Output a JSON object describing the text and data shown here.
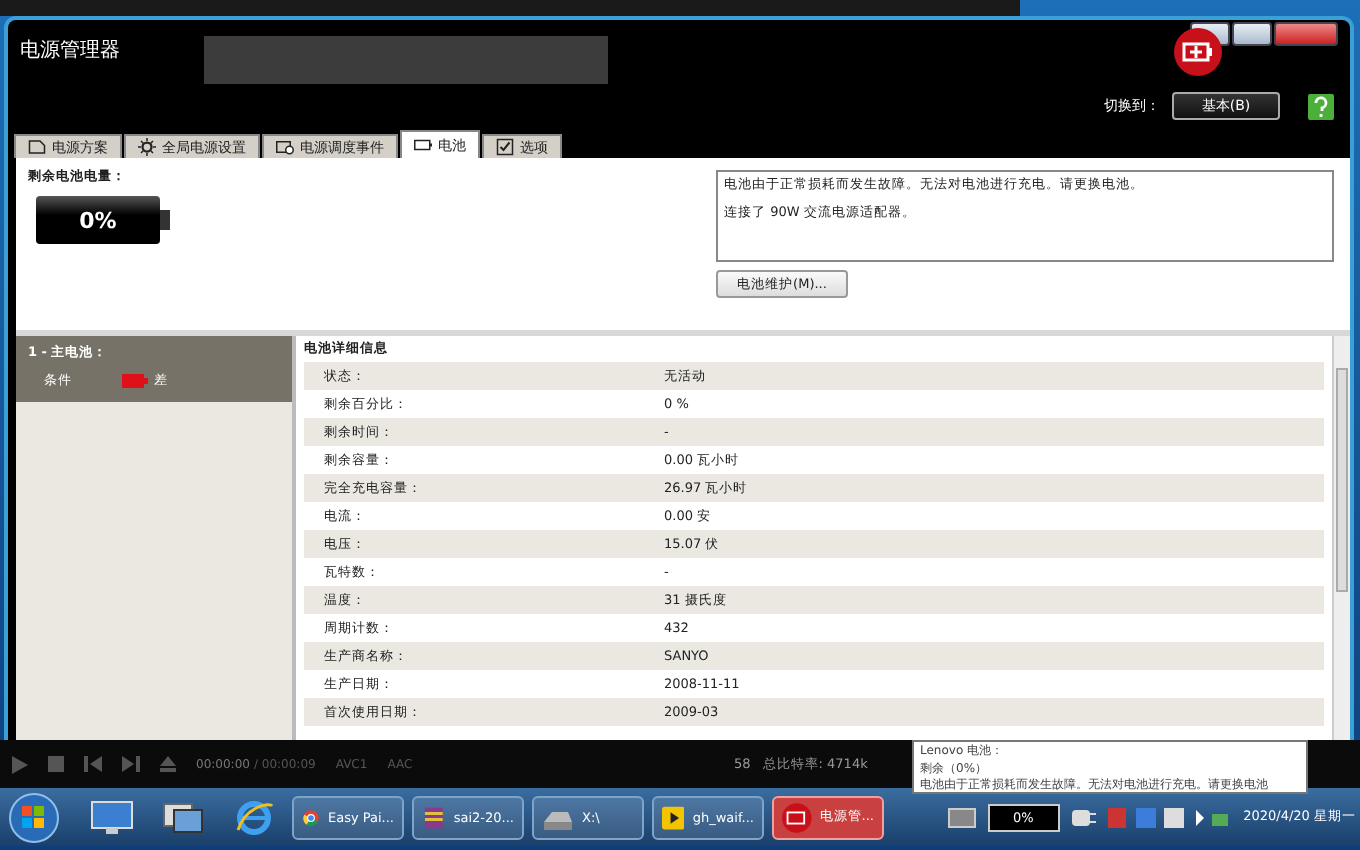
{
  "window": {
    "title": "电源管理器"
  },
  "switcher": {
    "label": "切换到：",
    "button": "基本(B)"
  },
  "tabs": [
    {
      "label": "电源方案",
      "kind": "plan",
      "selected": false
    },
    {
      "label": "全局电源设置",
      "kind": "gear",
      "selected": false
    },
    {
      "label": "电源调度事件",
      "kind": "event",
      "selected": false
    },
    {
      "label": "电池",
      "kind": "battery",
      "selected": true
    },
    {
      "label": "选项",
      "kind": "check",
      "selected": false
    }
  ],
  "battery_summary": {
    "label": "剩余电池电量：",
    "reading": "0%",
    "level": 0
  },
  "messages": [
    "电池由于正常损耗而发生故障。无法对电池进行充电。请更换电池。",
    "连接了 90W 交流电源适配器。"
  ],
  "maintenance_button": "电池维护(M)...",
  "battery_list": {
    "header": "1 - 主电池：",
    "condition_label": "条件",
    "condition": "差"
  },
  "details": {
    "title": "电池详细信息",
    "rows": [
      {
        "label": "状态：",
        "value": "无活动"
      },
      {
        "label": "剩余百分比：",
        "value": "0 %"
      },
      {
        "label": "剩余时间：",
        "value": "-"
      },
      {
        "label": "剩余容量：",
        "value": "0.00 瓦小时"
      },
      {
        "label": "完全充电容量：",
        "value": "26.97 瓦小时"
      },
      {
        "label": "电流：",
        "value": "0.00 安"
      },
      {
        "label": "电压：",
        "value": "15.07 伏"
      },
      {
        "label": "瓦特数：",
        "value": "-"
      },
      {
        "label": "温度：",
        "value": "31 摄氏度"
      },
      {
        "label": "周期计数：",
        "value": "432"
      },
      {
        "label": "生产商名称：",
        "value": "SANYO"
      },
      {
        "label": "生产日期：",
        "value": "2008-11-11"
      },
      {
        "label": "首次使用日期：",
        "value": "2009-03"
      }
    ]
  },
  "player": {
    "time": "00:00:00",
    "duration": "/ 00:00:09",
    "codecs": [
      "AVC1",
      "AAC"
    ],
    "info": [
      "58",
      "总比特率: 4714k"
    ]
  },
  "tooltip": [
    "Lenovo 电池：",
    "剩余（0%）",
    "电池由于正常损耗而发生故障。无法对电池进行充电。请更换电池"
  ],
  "taskbar": {
    "tasks": [
      {
        "label": "Easy Pai...",
        "kind": "browser",
        "selected": false
      },
      {
        "label": "sai2-20...",
        "kind": "archive",
        "selected": false
      },
      {
        "label": "X:\\",
        "kind": "drive",
        "selected": false
      },
      {
        "label": "gh_waif...",
        "kind": "player",
        "selected": false
      },
      {
        "label": "电源管...",
        "kind": "power",
        "selected": true
      }
    ],
    "battery": "0%",
    "date": "2020/4/20 星期一"
  }
}
